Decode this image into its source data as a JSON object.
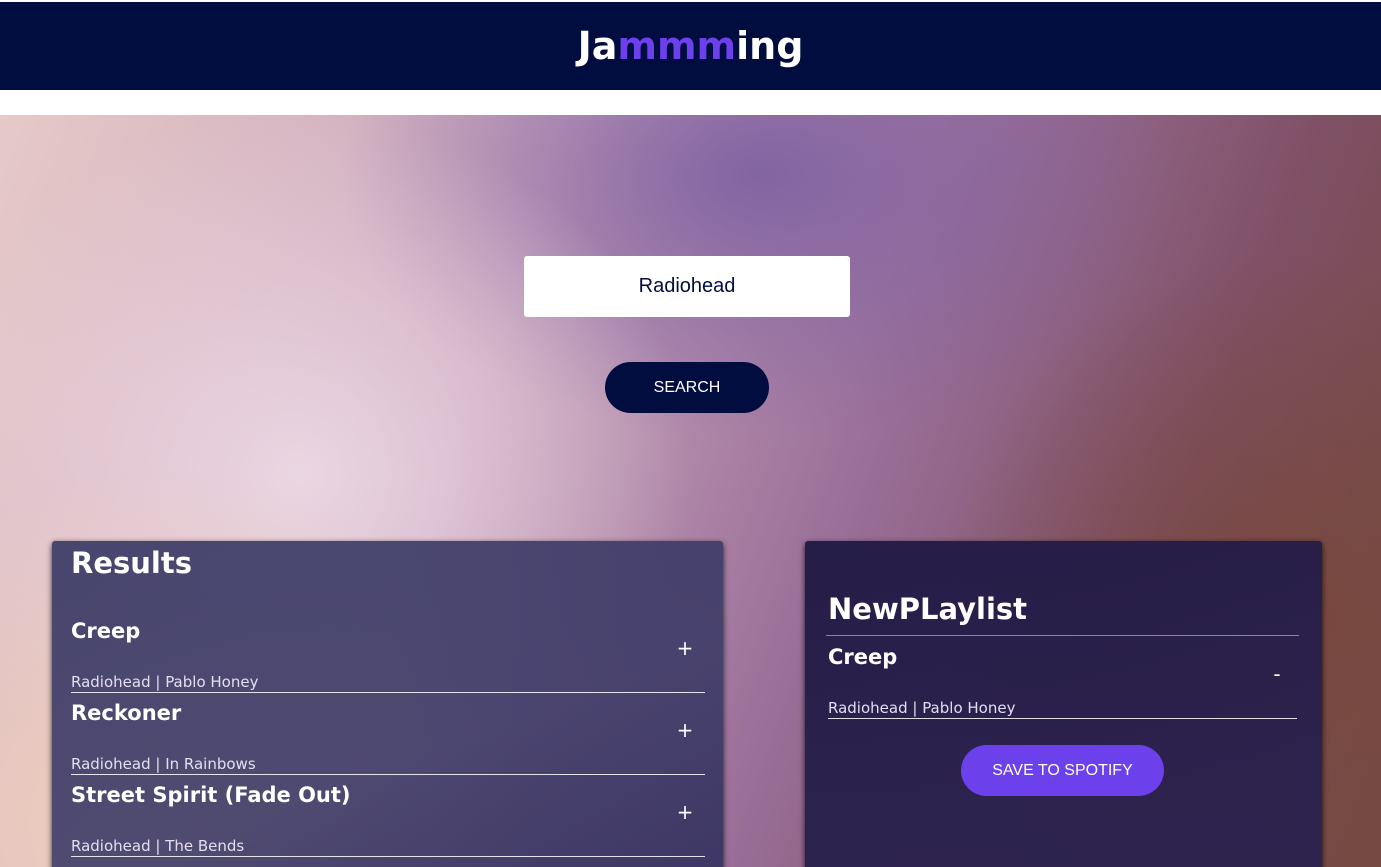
{
  "header": {
    "logo_prefix": "Ja",
    "logo_accent": "mmm",
    "logo_suffix": "ing"
  },
  "colors": {
    "header_bg": "#010c3f",
    "accent": "#6c41ec",
    "button_dark": "#010c3f"
  },
  "search": {
    "value": "Radiohead",
    "button_label": "SEARCH"
  },
  "results": {
    "title": "Results",
    "tracks": [
      {
        "name": "Creep",
        "info": "Radiohead | Pablo Honey",
        "action": "+"
      },
      {
        "name": "Reckoner",
        "info": "Radiohead | In Rainbows",
        "action": "+"
      },
      {
        "name": "Street Spirit (Fade Out)",
        "info": "Radiohead | The Bends",
        "action": "+"
      }
    ]
  },
  "playlist": {
    "title": "NewPLaylist",
    "tracks": [
      {
        "name": "Creep",
        "info": "Radiohead | Pablo Honey",
        "action": "-"
      }
    ],
    "save_label": "SAVE TO SPOTIFY"
  }
}
